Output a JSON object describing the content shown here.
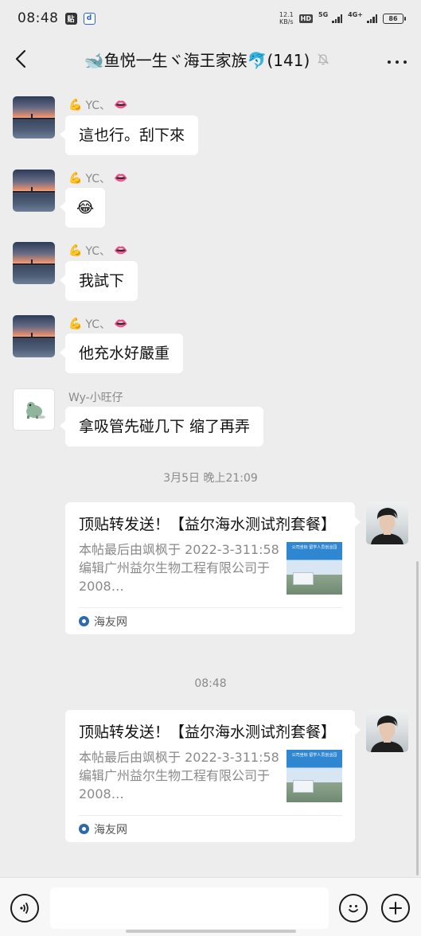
{
  "status_bar": {
    "time": "08:48",
    "net_speed": "12.1",
    "net_unit": "KB/s",
    "hd": "HD",
    "gen1": "5G",
    "gen2": "4G+",
    "battery": "86"
  },
  "header": {
    "title": "🐋鱼悦一生ヾ海王家族🐬(141)"
  },
  "messages": [
    {
      "sender_emoji": "💪",
      "sender_name": "YC、",
      "sender_tail": "👄",
      "text": "這也行。刮下來"
    },
    {
      "sender_emoji": "💪",
      "sender_name": "YC、",
      "sender_tail": "👄",
      "text": "😂"
    },
    {
      "sender_emoji": "💪",
      "sender_name": "YC、",
      "sender_tail": "👄",
      "text": "我試下"
    },
    {
      "sender_emoji": "💪",
      "sender_name": "YC、",
      "sender_tail": "👄",
      "text": "他充水好嚴重"
    },
    {
      "sender_name": "Wy-小旺仔",
      "text": "拿吸管先碰几下 缩了再弄"
    }
  ],
  "timestamps": [
    "3月5日 晚上21:09",
    "08:48"
  ],
  "cards": [
    {
      "title": "顶贴转发送！【益尔海水测试剂套餐】",
      "desc": "本帖最后由飒枫于 2022-3-311:58编辑广州益尔生物工程有限公司于2008…",
      "thumb_text": "公司坐标\n留学人员创业园",
      "source": "海友网"
    },
    {
      "title": "顶贴转发送！【益尔海水测试剂套餐】",
      "desc": "本帖最后由飒枫于 2022-3-311:58编辑广州益尔生物工程有限公司于2008…",
      "thumb_text": "公司坐标\n留学人员创业园",
      "source": "海友网"
    }
  ],
  "input": {
    "value": "",
    "placeholder": ""
  }
}
